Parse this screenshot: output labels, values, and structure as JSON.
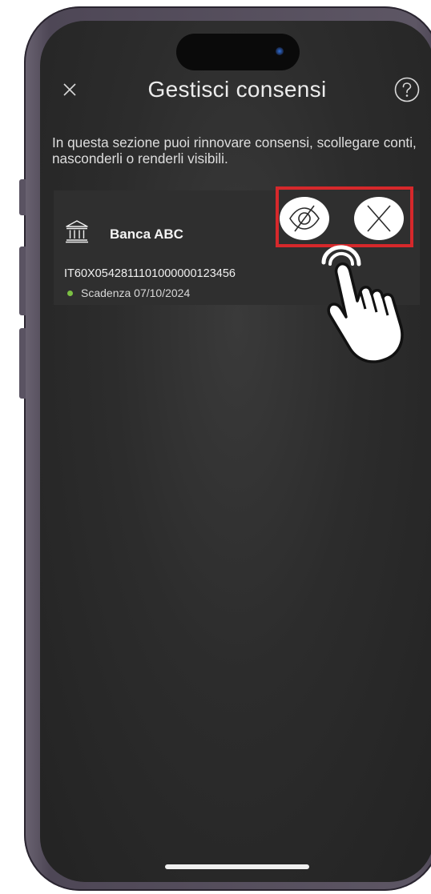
{
  "header": {
    "title": "Gestisci consensi",
    "close_icon": "close-icon",
    "help_icon": "help-icon"
  },
  "intro_text": "In questa sezione puoi rinnovare consensi, scollegare conti, nasconderli o renderli visibili.",
  "account_card": {
    "bank_icon": "bank-icon",
    "bank_name": "Banca ABC",
    "iban": "IT60X0542811101000000123456",
    "expiry_label": "Scadenza 07/10/2024",
    "status_color": "#7bc043",
    "actions": [
      {
        "icon": "eye-slash-icon"
      },
      {
        "icon": "close-icon"
      }
    ]
  },
  "colors": {
    "screen_background": "#2c2c2c",
    "card_background": "#2f2f2f",
    "highlight": "#d6282b",
    "text": "#ececec"
  }
}
